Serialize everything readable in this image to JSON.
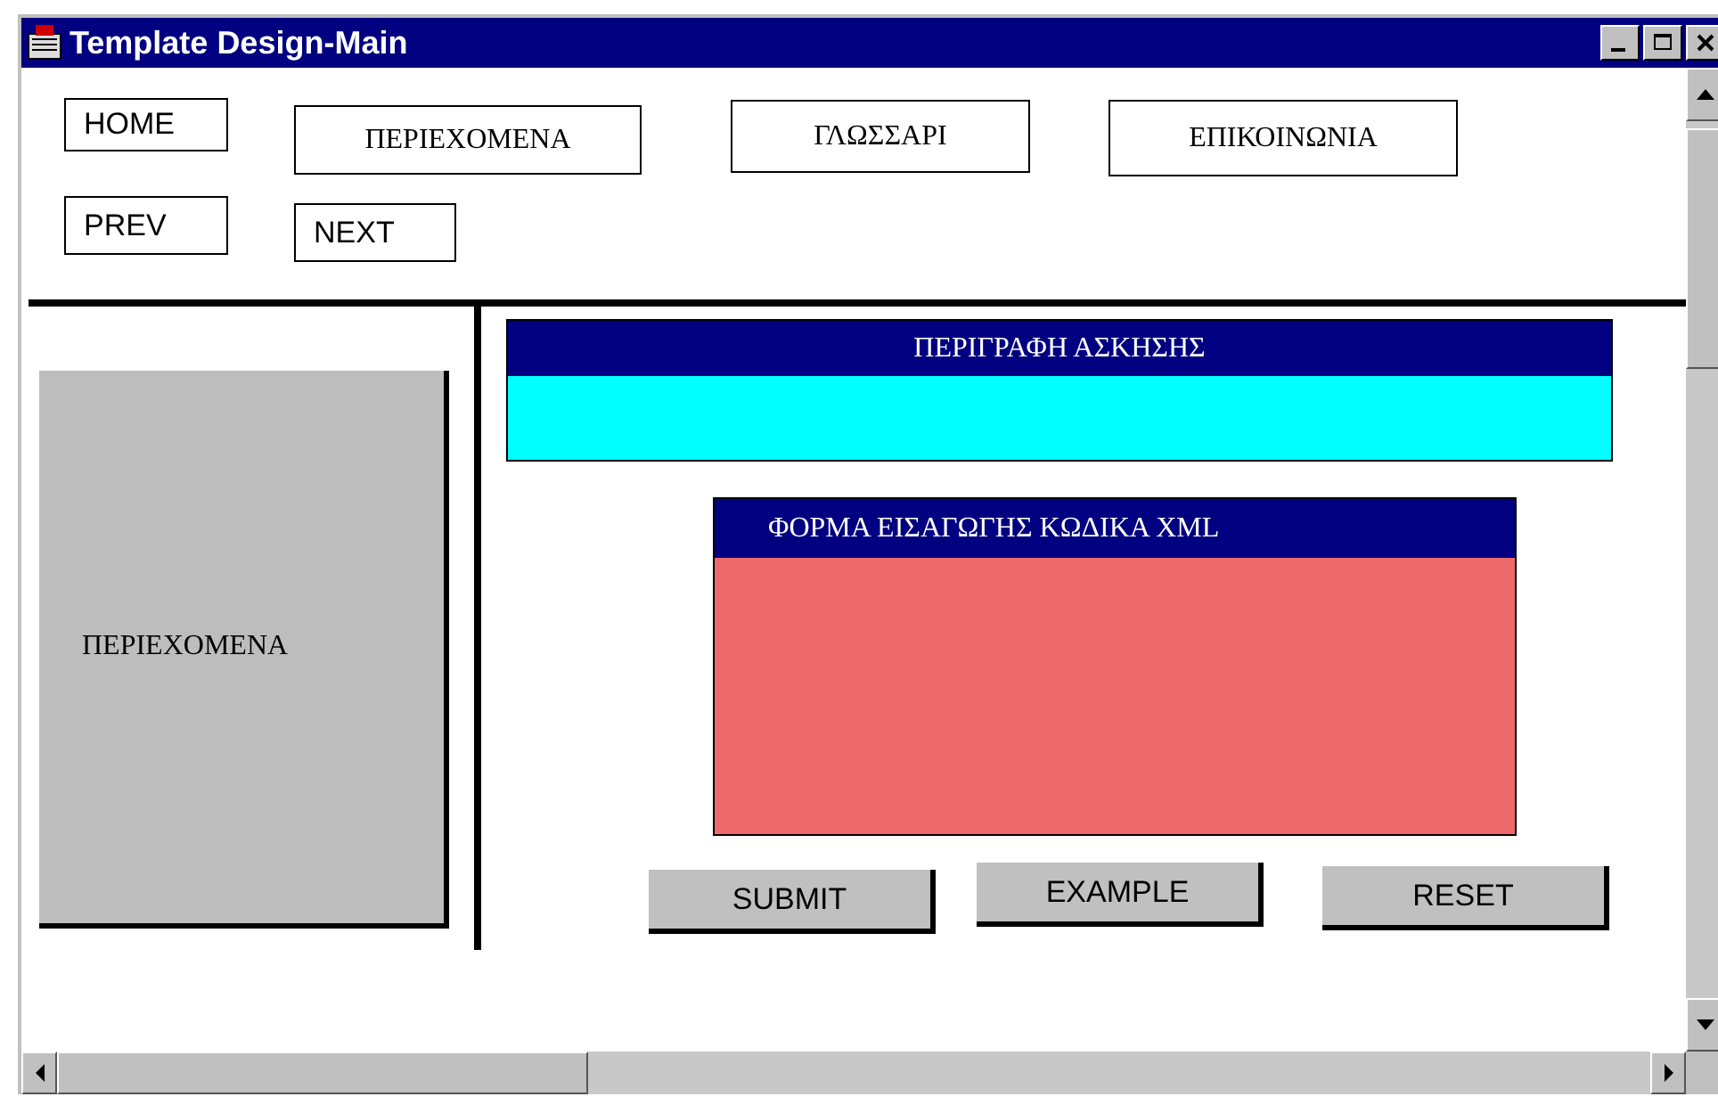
{
  "window": {
    "title": "Template Design-Main"
  },
  "nav_buttons": [
    {
      "label": "HOME",
      "kind": "latin"
    },
    {
      "label": "ΠΕΡΙΕΧΟΜΕΝΑ",
      "kind": "greek"
    },
    {
      "label": "ΓΛΩΣΣΑΡΙ",
      "kind": "greek"
    },
    {
      "label": "ΕΠΙΚΟΙΝΩΝΙΑ",
      "kind": "greek"
    },
    {
      "label": "PREV",
      "kind": "latin"
    },
    {
      "label": "NEXT",
      "kind": "latin"
    }
  ],
  "sidebar": {
    "label": "ΠΕΡΙΕΧΟΜΕΝΑ"
  },
  "description_panel": {
    "title": "ΠΕΡΙΓΡΑΦΗ ΑΣΚΗΣΗΣ"
  },
  "xml_form": {
    "title": "ΦΟΡΜΑ ΕΙΣΑΓΩΓΗΣ ΚΩΔΙΚΑ XML"
  },
  "action_buttons": [
    "SUBMIT",
    "EXAMPLE",
    "RESET"
  ]
}
